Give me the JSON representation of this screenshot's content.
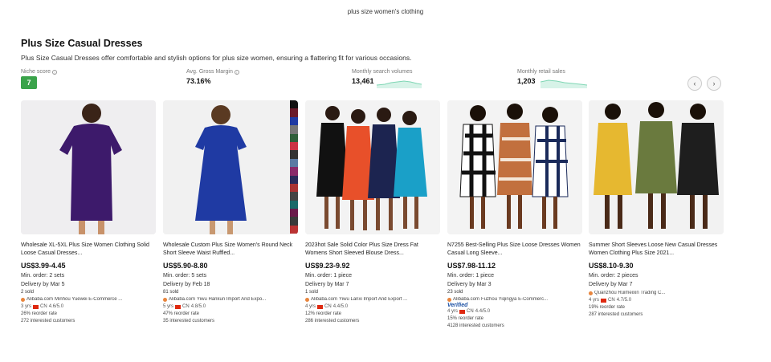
{
  "search": {
    "query": "plus size women's clothing"
  },
  "section": {
    "title": "Plus Size Casual Dresses",
    "description": "Plus Size Casual Dresses offer comfortable and stylish options for plus size women, ensuring a flattering fit for various occasions."
  },
  "metrics": {
    "niche_score": {
      "label": "Niche score",
      "value": "7",
      "color": "#3aa34a"
    },
    "gross_margin": {
      "label": "Avg. Gross Margin",
      "value": "73.16%"
    },
    "search_volume": {
      "label": "Monthly search volumes",
      "value": "13,461"
    },
    "retail_sales": {
      "label": "Monthly retail sales",
      "value": "1,203"
    }
  },
  "nav": {
    "prev": "‹",
    "next": "›"
  },
  "products": [
    {
      "title": "Wholesale XL-5XL Plus Size Women Clothing Solid Loose Casual Dresses...",
      "price": "US$3.99-4.45",
      "min_order": "Min. order: 2 sets",
      "delivery": "Delivery by Mar 5",
      "sold": "2 sold",
      "site": "Alibaba.com",
      "supplier": "Minhou Yuewei E-Commerce ...",
      "years": "3 yrs",
      "country": "CN",
      "rating": "4.6/5.0",
      "verified": "",
      "reorder": "26% reorder rate",
      "interested": "272 interested customers"
    },
    {
      "title": "Wholesale Custom Plus Size Women's Round Neck Short Sleeve Waist Ruffled...",
      "price": "US$5.90-8.80",
      "min_order": "Min. order: 5 sets",
      "delivery": "Delivery by Feb 18",
      "sold": "81 sold",
      "site": "Alibaba.com",
      "supplier": "Yiwu Hankun Import And Expo...",
      "years": "5 yrs",
      "country": "CN",
      "rating": "4.8/5.0",
      "verified": "",
      "reorder": "47% reorder rate",
      "interested": "35 interested customers"
    },
    {
      "title": "2023hot Sale Solid Color Plus Size Dress Fat Womens Short Sleeved Blouse Dress...",
      "price": "US$9.23-9.92",
      "min_order": "Min. order: 1 piece",
      "delivery": "Delivery by Mar 7",
      "sold": "1 sold",
      "site": "Alibaba.com",
      "supplier": "Yiwu Lanxi Import And Export ...",
      "years": "4 yrs",
      "country": "CN",
      "rating": "4.4/5.0",
      "verified": "",
      "reorder": "12% reorder rate",
      "interested": "286 interested customers"
    },
    {
      "title": "N7255 Best-Selling Plus Size Loose Dresses Women Casual Long Sleeve...",
      "price": "US$7.98-11.12",
      "min_order": "Min. order: 1 piece",
      "delivery": "Delivery by Mar 3",
      "sold": "23 sold",
      "site": "Alibaba.com",
      "supplier": "Fuzhou Yiqingya E-Commerc...",
      "years": "4 yrs",
      "country": "CN",
      "rating": "4.4/5.0",
      "verified": "Verified",
      "reorder": "15% reorder rate",
      "interested": "4128 interested customers"
    },
    {
      "title": "Summer Short Sleeves Loose New Casual Dresses Women Clothing Plus Size 2021...",
      "price": "US$8.10-9.30",
      "min_order": "Min. order: 2 pieces",
      "delivery": "Delivery by Mar 7",
      "sold": "",
      "site": "",
      "supplier": "Quanzhou Ruimeixin Trading C...",
      "years": "4 yrs",
      "country": "CN",
      "rating": "4.7/5.0",
      "verified": "",
      "reorder": "19% reorder rate",
      "interested": "287 interested customers"
    }
  ]
}
